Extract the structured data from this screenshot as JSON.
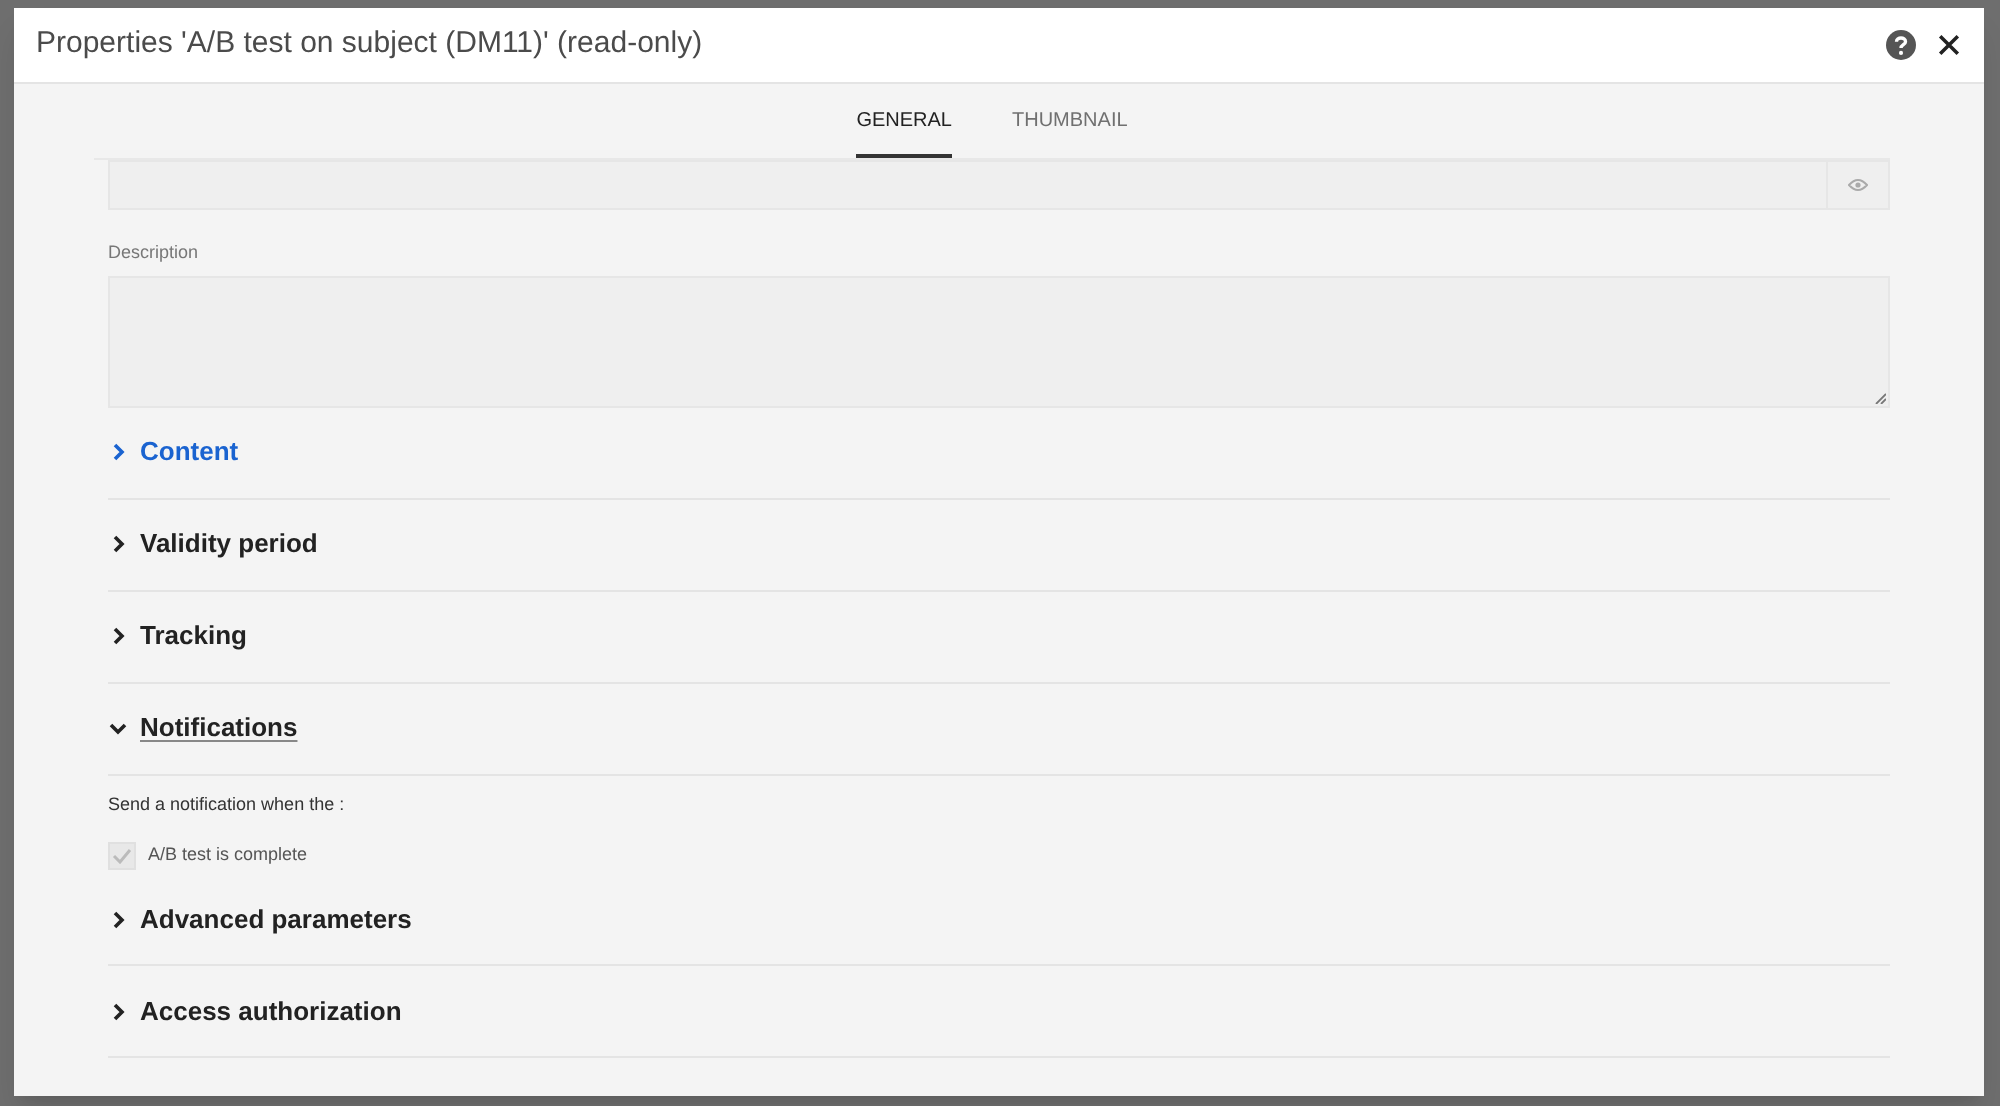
{
  "dialog": {
    "title": "Properties 'A/B test on subject (DM11)' (read-only)"
  },
  "tabs": [
    {
      "label": "GENERAL",
      "selected": true
    },
    {
      "label": "THUMBNAIL",
      "selected": false
    }
  ],
  "description": {
    "label": "Description"
  },
  "sections": [
    {
      "label": "Content",
      "expanded": false,
      "highlighted": true,
      "focused": false
    },
    {
      "label": "Validity period",
      "expanded": false,
      "highlighted": false,
      "focused": false
    },
    {
      "label": "Tracking",
      "expanded": false,
      "highlighted": false,
      "focused": false
    },
    {
      "label": "Notifications",
      "expanded": true,
      "highlighted": false,
      "focused": true,
      "body": {
        "text": "Send a notification when the :",
        "checkbox": {
          "label": "A/B test is complete",
          "checked": true,
          "disabled": true
        }
      }
    },
    {
      "label": "Advanced parameters",
      "expanded": false,
      "highlighted": false,
      "focused": false
    },
    {
      "label": "Access authorization",
      "expanded": false,
      "highlighted": false,
      "focused": false
    }
  ]
}
